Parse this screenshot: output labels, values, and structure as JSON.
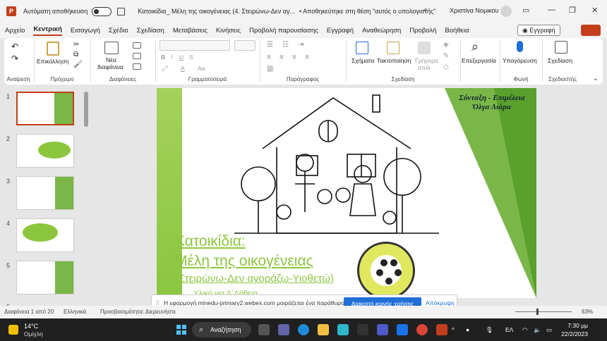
{
  "titlebar": {
    "autosave_label": "Αυτόματη αποθήκευση",
    "doc_title": "Κατοικίδια_ Μέλη της οικογένειας (4. Στειρώνω-Δεν αγ...",
    "save_location": "• Αποθηκεύτηκε στη θέση \"αυτός ο υπολογιστής\"",
    "user_name": "Χριστίνα Νομικου"
  },
  "menu": {
    "tabs": [
      "Αρχείο",
      "Κεντρική",
      "Εισαγωγή",
      "Σχέδιο",
      "Σχεδίαση",
      "Μεταβάσεις",
      "Κινήσεις",
      "Προβολή παρουσίασης",
      "Εγγραφή",
      "Αναθεώρηση",
      "Προβολή",
      "Βοήθεια"
    ],
    "record_label": "Εγγραφή"
  },
  "ribbon": {
    "paste_label": "Επικόλληση",
    "new_slide_label_1": "Νέα",
    "new_slide_label_2": "διαφάνεια",
    "shapes_label": "Σχήματα",
    "arrange_label": "Τακτοποίηση",
    "quick_styles_label_1": "Γρήγορα",
    "quick_styles_label_2": "στυλ",
    "find_label": "Επεξεργασία",
    "dictate_label": "Υπαγόρευση",
    "designer_label": "Σχεδίαση",
    "groups": {
      "undo": "Αναίρεση",
      "clipboard": "Πρόχειρο",
      "slides": "Διαφάνειες",
      "font": "Γραμματοσειρά",
      "paragraph": "Παράγραφος",
      "drawing": "Σχεδίαση",
      "voice": "Φωνή",
      "designer": "Σχεδιαστής"
    }
  },
  "thumbnails": [
    "1",
    "2",
    "3",
    "4",
    "5",
    "6"
  ],
  "slide": {
    "author_line1": "Σύνταξη - Επιμέλεια",
    "author_line2": "Όλγα Λιάρα",
    "title1": "Κατοικίδια:",
    "title2": "Μέλη της οικογένειας",
    "subtitle": "(Στειρώνω-Δεν αγοράζω-Υιοθετώ)",
    "class_line": "Υλικό για Δ΄Δήθεια"
  },
  "share_bar": {
    "message": "Η εφαρμογή minedu-primary2.webex.com μοιράζεται ένα παράθυρο.",
    "stop_label": "Διακοπή κοινής χρήσης",
    "hide_label": "Απόκρυψη"
  },
  "statusbar": {
    "slide_info": "Διαφάνεια 1 από 20",
    "language": "Ελληνικά",
    "accessibility": "Προσβασιμότητα: Διερευνήστε",
    "zoom": "63%"
  },
  "taskbar": {
    "temperature": "14°C",
    "weather": "Ομίχλη",
    "search_label": "Αναζήτηση",
    "lang": "ΕΛ",
    "time": "7:30 μμ",
    "date": "22/2/2023"
  }
}
